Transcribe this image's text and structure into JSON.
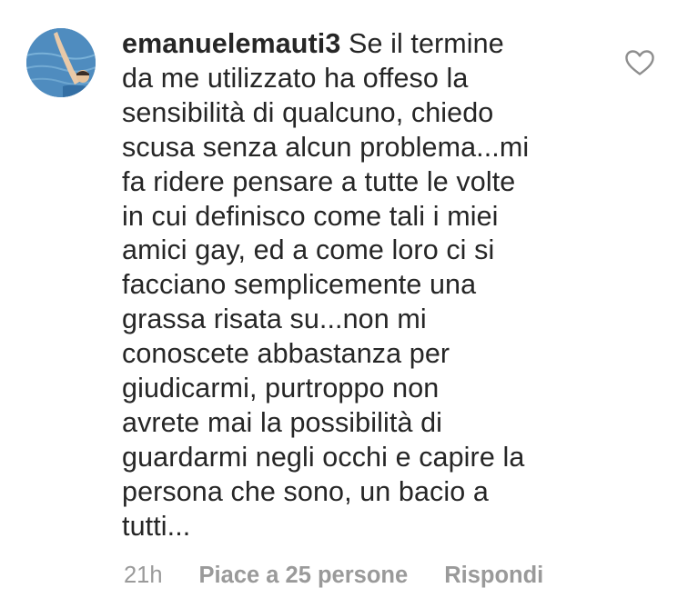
{
  "comment": {
    "username": "emanuelemauti3",
    "text": " Se il termine\nda me utilizzato ha offeso la\nsensibilità di qualcuno, chiedo\nscusa senza alcun problema...mi\nfa ridere pensare a tutte le volte\nin cui definisco come tali i miei\namici gay, ed a come loro ci si\nfacciano semplicemente una\ngrassa risata su...non mi\nconoscete abbastanza per\ngiudicarmi, purtroppo non\navrete mai la possibilità di\nguardarmi negli occhi e capire la\npersona che sono, un bacio a\ntutti...",
    "time": "21h",
    "likes_label": "Piace a 25 persone",
    "reply_label": "Rispondi"
  },
  "icons": {
    "like": "heart-outline-icon",
    "avatar": "profile-photo-swimmer"
  },
  "colors": {
    "text": "#262626",
    "meta": "#9a9a9a",
    "heart_stroke": "#8e8e8e"
  }
}
